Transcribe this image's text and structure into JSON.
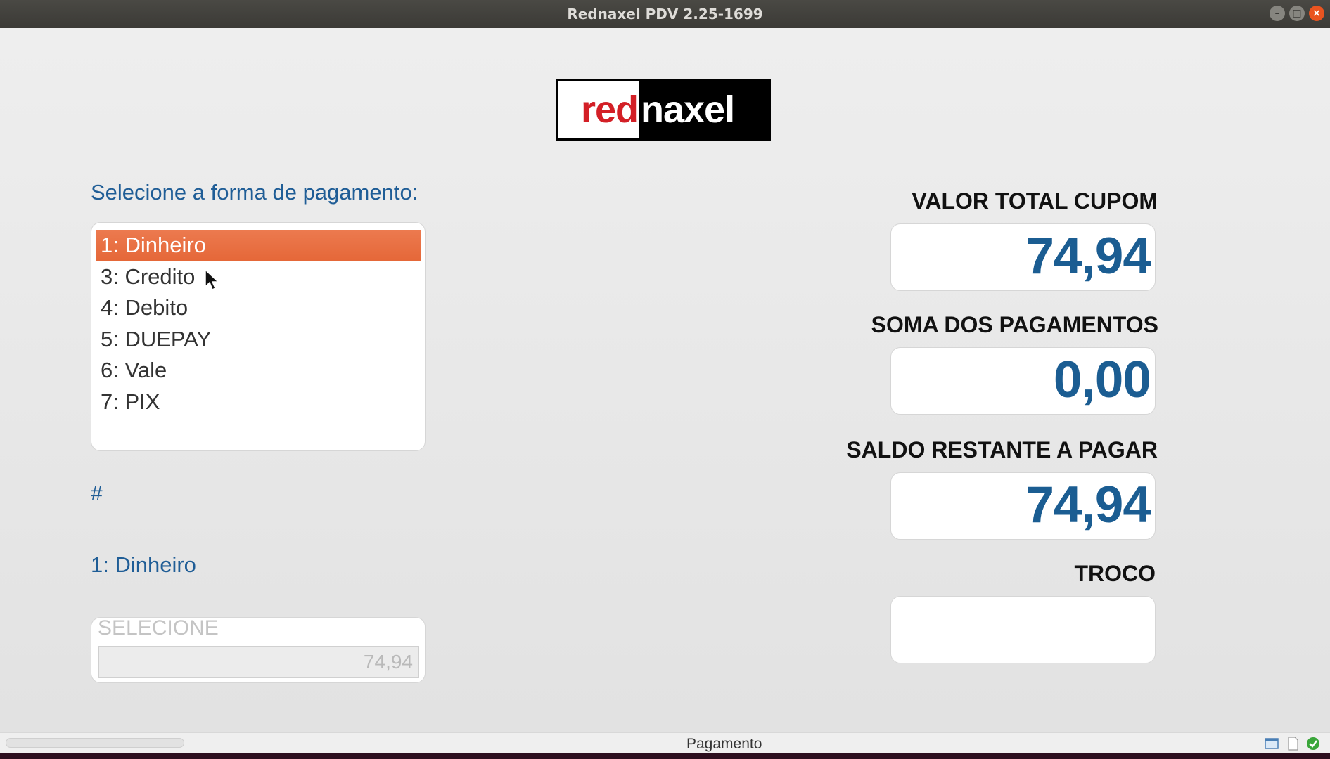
{
  "window": {
    "title": "Rednaxel PDV 2.25-1699"
  },
  "logo": {
    "part1": "red",
    "part2": "naxel"
  },
  "payment": {
    "prompt": "Selecione a forma de pagamento:",
    "options": [
      "1: Dinheiro",
      "3: Credito",
      "4: Debito",
      "5: DUEPAY",
      "6: Vale",
      "7: PIX"
    ],
    "selected_index": 0,
    "hash_label": "#",
    "chosen_method": "1: Dinheiro",
    "select_label": "SELECIONE",
    "amount_value": "74,94"
  },
  "summary": {
    "total_label": "VALOR TOTAL CUPOM",
    "total_value": "74,94",
    "paid_label": "SOMA DOS PAGAMENTOS",
    "paid_value": "0,00",
    "remaining_label": "SALDO RESTANTE A PAGAR",
    "remaining_value": "74,94",
    "change_label": "TROCO",
    "change_value": ""
  },
  "statusbar": {
    "text": "Pagamento"
  },
  "colors": {
    "accent": "#e56738",
    "value_blue": "#1b5d92",
    "label_blue": "#1f5d96"
  }
}
